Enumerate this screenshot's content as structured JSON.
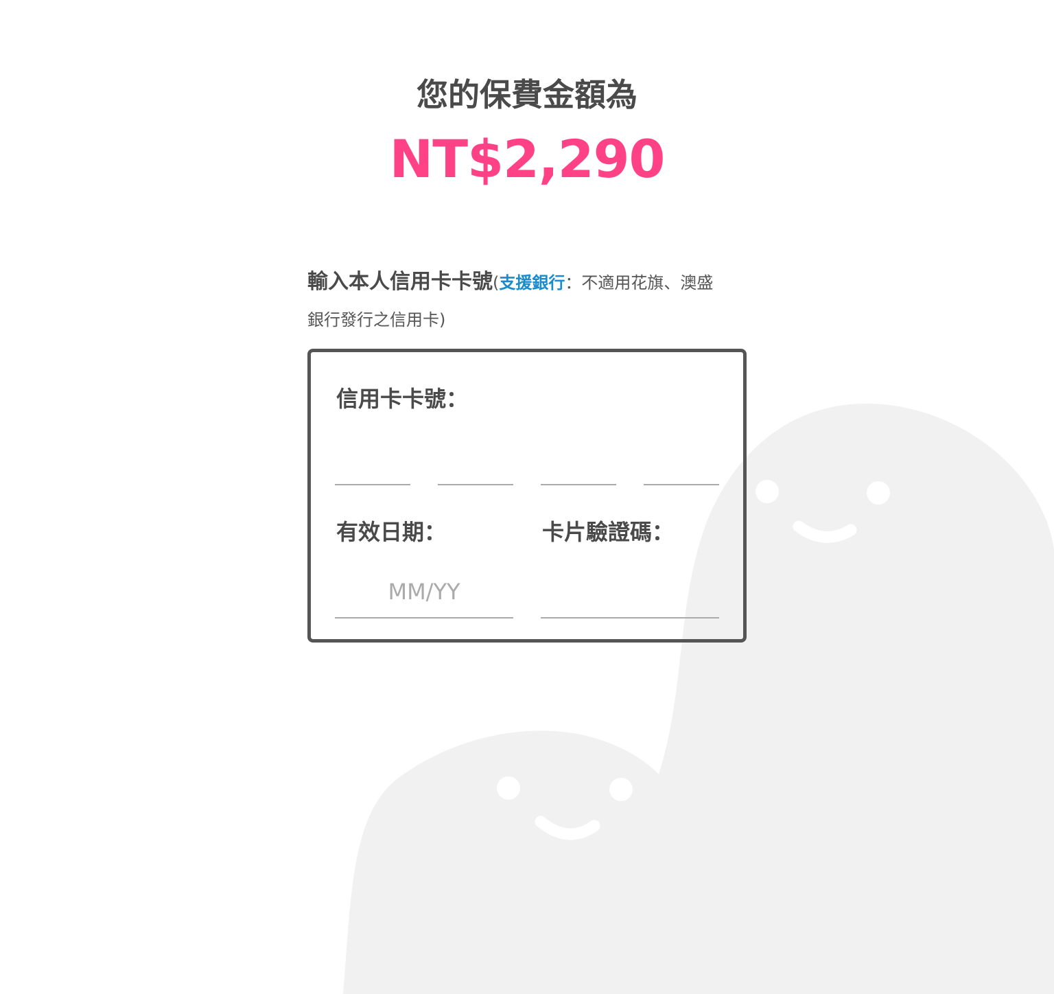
{
  "premium": {
    "title": "您的保費金額為",
    "amount": "NT$2,290"
  },
  "instruction": {
    "lead": "輸入本人信用卡卡號",
    "open_paren": "(",
    "link_label": "支援銀行",
    "note": "：不適用花旗、澳盛銀行發行之信用卡)"
  },
  "card_form": {
    "card_number_label": "信用卡卡號：",
    "card_number_segments": [
      "",
      "",
      "",
      ""
    ],
    "expiry_label": "有效日期：",
    "expiry_value": "",
    "expiry_placeholder": "MM/YY",
    "cvv_label": "卡片驗證碼：",
    "cvv_value": ""
  },
  "colors": {
    "accent_pink": "#ff4286",
    "link_blue": "#1a8ccc",
    "text_dark": "#4a4a4a",
    "border": "#555555",
    "ghost": "#f1f1f1"
  },
  "decoration": {
    "ghosts": [
      "ghost-large",
      "ghost-small"
    ]
  }
}
